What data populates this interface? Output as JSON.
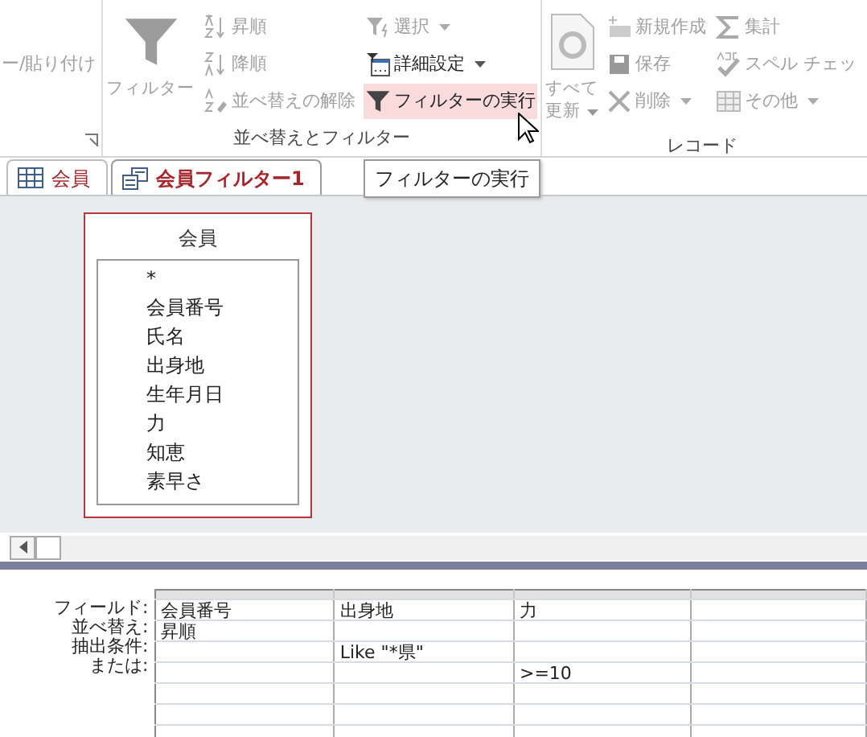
{
  "ribbon": {
    "clipboard_fragment": "ー/貼り付け",
    "groups": [
      {
        "label": "並べ替えとフィルター",
        "large": {
          "lines": [
            "フィルター"
          ],
          "disabled": true,
          "dropdown": false
        },
        "columns": [
          [
            {
              "label": "昇順",
              "disabled": true,
              "dropdown": false,
              "hovered": false
            },
            {
              "label": "降順",
              "disabled": true,
              "dropdown": false,
              "hovered": false
            },
            {
              "label": "並べ替えの解除",
              "disabled": true,
              "dropdown": false,
              "hovered": false
            }
          ],
          [
            {
              "label": "選択",
              "disabled": true,
              "dropdown": true,
              "hovered": false
            },
            {
              "label": "詳細設定",
              "disabled": false,
              "dropdown": true,
              "hovered": false
            },
            {
              "label": "フィルターの実行",
              "disabled": false,
              "dropdown": false,
              "hovered": true
            }
          ]
        ]
      },
      {
        "label": "レコード",
        "large": {
          "lines": [
            "すべて",
            "更新"
          ],
          "disabled": true,
          "dropdown": true
        },
        "columns": [
          [
            {
              "label": "新規作成",
              "disabled": true,
              "dropdown": false,
              "hovered": false
            },
            {
              "label": "保存",
              "disabled": true,
              "dropdown": false,
              "hovered": false
            },
            {
              "label": "削除",
              "disabled": true,
              "dropdown": true,
              "hovered": false
            }
          ],
          [
            {
              "label": "集計",
              "disabled": true,
              "dropdown": false,
              "hovered": false
            },
            {
              "label": "スペル チェッ",
              "disabled": true,
              "dropdown": false,
              "hovered": false
            },
            {
              "label": "その他",
              "disabled": true,
              "dropdown": true,
              "hovered": false
            }
          ]
        ]
      }
    ]
  },
  "tabs": [
    {
      "label": "会員",
      "selected": false
    },
    {
      "label": "会員フィルター1",
      "selected": true
    }
  ],
  "tooltip": "フィルターの実行",
  "field_list": {
    "title": "会員",
    "fields": [
      "*",
      "会員番号",
      "氏名",
      "出身地",
      "生年月日",
      "力",
      "知恵",
      "素早さ"
    ]
  },
  "grid": {
    "row_labels": [
      "フィールド:",
      "並べ替え:",
      "抽出条件:",
      "または:"
    ],
    "columns": [
      {
        "field": "会員番号",
        "sort": "昇順"
      },
      {
        "field": "出身地",
        "criteria": "Like \"*県\""
      },
      {
        "field": "力",
        "or": ">=10"
      }
    ]
  }
}
